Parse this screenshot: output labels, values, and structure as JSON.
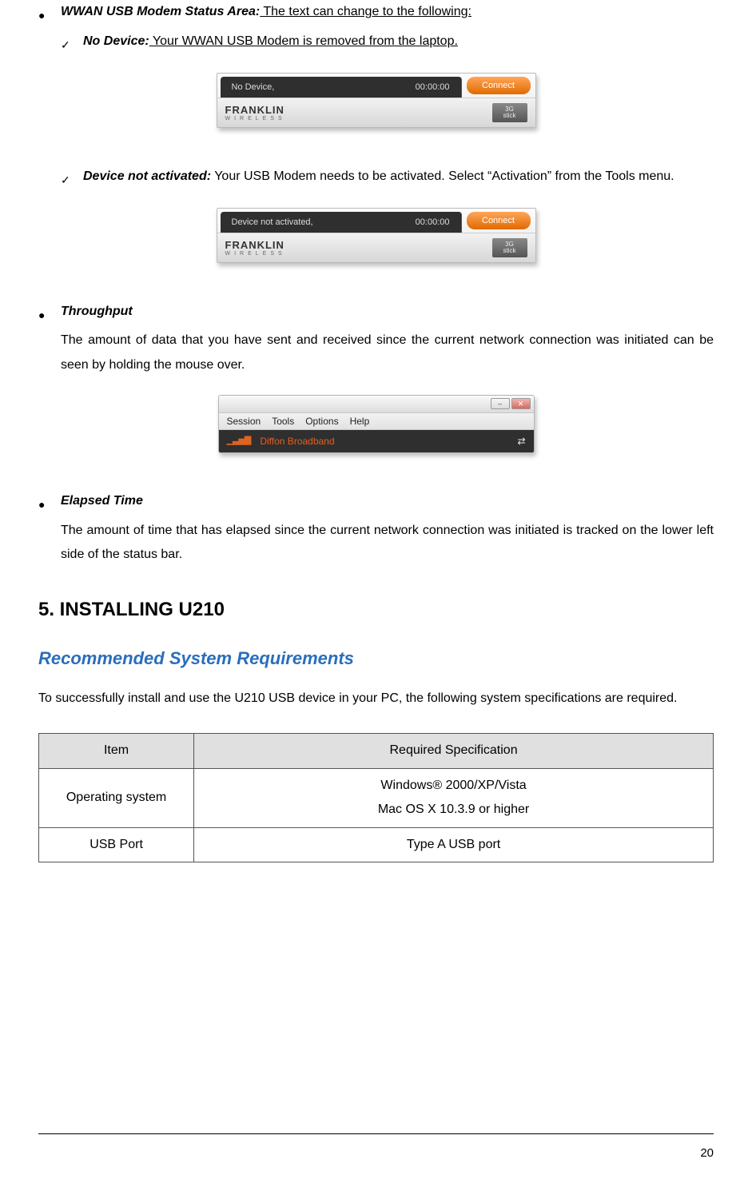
{
  "sections": {
    "wwan": {
      "title_bold": "WWAN USB Modem Status Area:",
      "title_rest": " The text can change to the following:",
      "no_device_label": "No Device:",
      "no_device_text": " Your WWAN USB Modem is removed from the laptop.",
      "not_activated_label": "Device not activated:",
      "not_activated_text": " Your USB Modem needs to be activated. Select “Activation” from the Tools menu."
    },
    "throughput": {
      "title": "Throughput",
      "text": "The amount of data that you have sent and received since the current network connection was initiated can be seen by holding the mouse over."
    },
    "elapsed": {
      "title": "Elapsed Time",
      "text": "The amount of time that has elapsed since the current network connection was initiated is tracked on the lower left side of the status bar."
    }
  },
  "install": {
    "heading": "5. INSTALLING U210",
    "subheading": "Recommended System Requirements",
    "intro": "To successfully install and use the U210 USB device in your PC, the following system specifications are required."
  },
  "table": {
    "head_item": "Item",
    "head_spec": "Required Specification",
    "os_label": "Operating system",
    "os_line1": "Windows® 2000/XP/Vista",
    "os_line2": "Mac OS X 10.3.9 or higher",
    "usb_label": "USB Port",
    "usb_spec": "Type A USB port"
  },
  "widgets": {
    "modem1": {
      "status": "No Device,",
      "time": "00:00:00",
      "connect": "Connect",
      "brand": "FRANKLIN",
      "brand_sub": "WIRELESS",
      "badge_top": "3G",
      "badge_bot": "stick"
    },
    "modem2": {
      "status": "Device not activated,",
      "time": "00:00:00",
      "connect": "Connect",
      "brand": "FRANKLIN",
      "brand_sub": "WIRELESS",
      "badge_top": "3G",
      "badge_bot": "stick"
    },
    "app": {
      "menu": {
        "session": "Session",
        "tools": "Tools",
        "options": "Options",
        "help": "Help"
      },
      "carrier": "Diffon Broadband",
      "win": {
        "min": "–",
        "close": "✕"
      },
      "xfer": "⇄"
    }
  },
  "page_number": "20"
}
